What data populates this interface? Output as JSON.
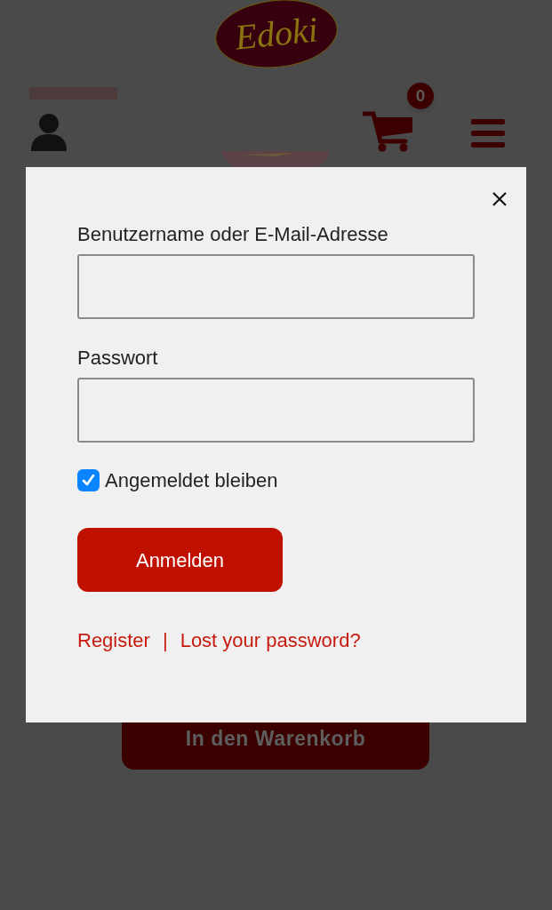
{
  "header": {
    "logo_text": "Edoki"
  },
  "nav": {
    "cart_count": "0"
  },
  "login_dialog": {
    "fields": [
      {
        "label": "Benutzername oder E-Mail-Adresse"
      },
      {
        "label": "Passwort"
      }
    ],
    "remember": {
      "label": "Angemeldet bleiben",
      "checked": true
    },
    "submit": "Anmelden",
    "links": [
      {
        "label": "Register"
      },
      {
        "label": "Lost your password?"
      }
    ],
    "separator": "|"
  },
  "add_to_cart": "In den Warenkorb"
}
